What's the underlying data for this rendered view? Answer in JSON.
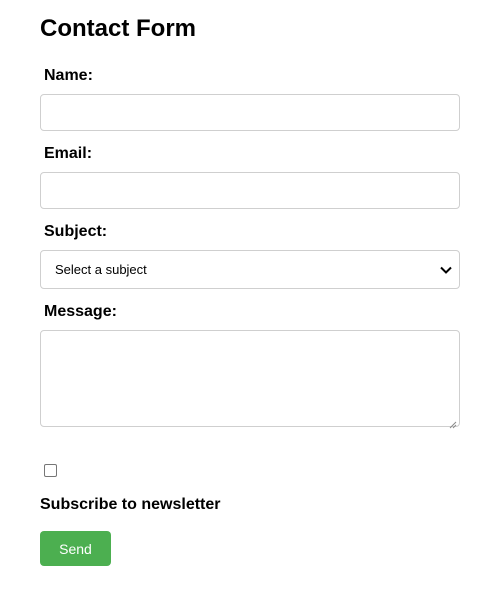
{
  "form": {
    "title": "Contact Form",
    "name_label": "Name:",
    "name_value": "",
    "email_label": "Email:",
    "email_value": "",
    "subject_label": "Subject:",
    "subject_selected": "Select a subject",
    "message_label": "Message:",
    "message_value": "",
    "newsletter_label": "Subscribe to newsletter",
    "newsletter_checked": false,
    "send_label": "Send"
  },
  "icons": {
    "select_arrow": "chevron-down-icon",
    "resize_handle": "resize-grip-icon"
  },
  "colors": {
    "send_button_bg": "#4caf50",
    "send_button_text": "#ffffff",
    "field_border": "#cfcfcf"
  }
}
